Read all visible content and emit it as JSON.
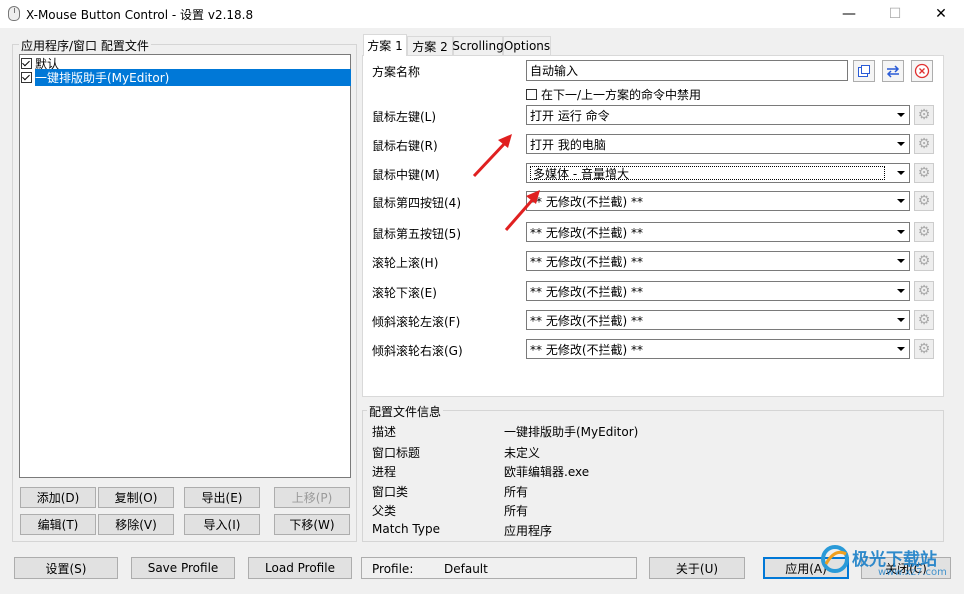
{
  "window": {
    "title": "X-Mouse Button Control - 设置 v2.18.8",
    "minimize": "—",
    "maximize": "☐",
    "close": "✕"
  },
  "profiles": {
    "group_label": "应用程序/窗口 配置文件",
    "items": [
      {
        "label": "默认",
        "checked": true,
        "selected": false
      },
      {
        "label": "一键排版助手(MyEditor)",
        "checked": true,
        "selected": true
      }
    ],
    "buttons": {
      "add": "添加(D)",
      "copy": "复制(O)",
      "export": "导出(E)",
      "move_up": "上移(P)",
      "edit": "编辑(T)",
      "remove": "移除(V)",
      "import": "导入(I)",
      "move_down": "下移(W)"
    }
  },
  "tabs": [
    {
      "label": "方案 1",
      "active": true
    },
    {
      "label": "方案 2",
      "active": false
    },
    {
      "label": "Scrolling",
      "active": false
    },
    {
      "label": "Options",
      "active": false
    }
  ],
  "scheme": {
    "name_label": "方案名称",
    "name_value": "自动输入",
    "disable_checkbox_label": "在下一/上一方案的命令中禁用",
    "disable_checked": false,
    "rows": [
      {
        "label": "鼠标左键(L)",
        "value": "打开 运行 命令"
      },
      {
        "label": "鼠标右键(R)",
        "value": "打开 我的电脑"
      },
      {
        "label": "鼠标中键(M)",
        "value": "多媒体 - 音量增大"
      },
      {
        "label": "鼠标第四按钮(4)",
        "value": "** 无修改(不拦截) **"
      },
      {
        "label": "鼠标第五按钮(5)",
        "value": "** 无修改(不拦截) **"
      },
      {
        "label": "滚轮上滚(H)",
        "value": "** 无修改(不拦截) **"
      },
      {
        "label": "滚轮下滚(E)",
        "value": "** 无修改(不拦截) **"
      },
      {
        "label": "倾斜滚轮左滚(F)",
        "value": "** 无修改(不拦截) **"
      },
      {
        "label": "倾斜滚轮右滚(G)",
        "value": "** 无修改(不拦截) **"
      }
    ]
  },
  "profile_info": {
    "group_label": "配置文件信息",
    "rows": [
      {
        "key": "描述",
        "value": "一键排版助手(MyEditor)"
      },
      {
        "key": "窗口标题",
        "value": "未定义"
      },
      {
        "key": "进程",
        "value": "欧菲编辑器.exe"
      },
      {
        "key": "窗口类",
        "value": "所有"
      },
      {
        "key": "父类",
        "value": "所有"
      },
      {
        "key": "Match Type",
        "value": "应用程序"
      }
    ]
  },
  "footer": {
    "settings": "设置(S)",
    "save_profile": "Save Profile",
    "load_profile": "Load Profile",
    "status_label": "Profile:",
    "status_value": "Default",
    "about": "关于(U)",
    "apply": "应用(A)",
    "close": "关闭(C)"
  },
  "watermark": {
    "text": "极光下载站",
    "url": "www.xz7.com"
  },
  "colors": {
    "selection": "#0078d7",
    "arrow": "#e02020"
  }
}
